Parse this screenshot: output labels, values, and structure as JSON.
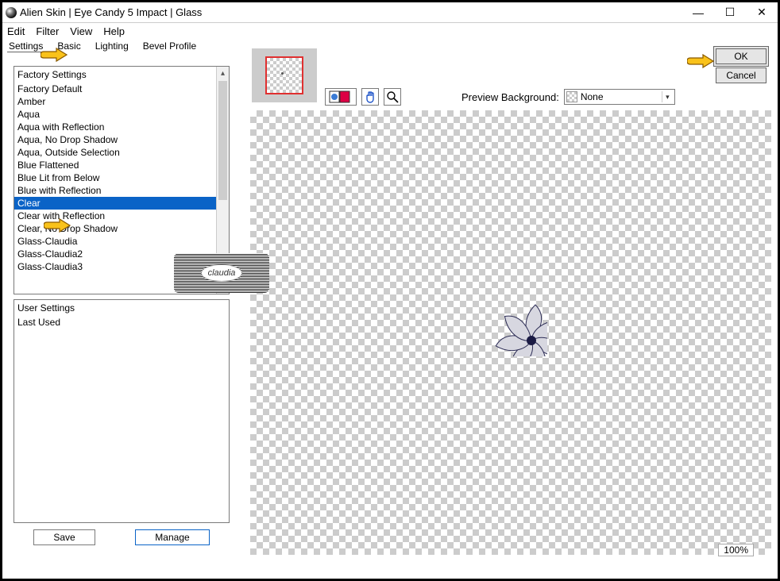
{
  "window": {
    "title": "Alien Skin | Eye Candy 5 Impact | Glass"
  },
  "menu": {
    "edit": "Edit",
    "filter": "Filter",
    "view": "View",
    "help": "Help"
  },
  "tabs": {
    "settings": "Settings",
    "basic": "Basic",
    "lighting": "Lighting",
    "bevel": "Bevel Profile"
  },
  "presets": {
    "header": "Factory Settings",
    "items": [
      "Factory Default",
      "Amber",
      "Aqua",
      "Aqua with Reflection",
      "Aqua, No Drop Shadow",
      "Aqua, Outside Selection",
      "Blue Flattened",
      "Blue Lit from Below",
      "Blue with Reflection",
      "Clear",
      "Clear with Reflection",
      "Clear, No Drop Shadow",
      "Glass-Claudia",
      "Glass-Claudia2",
      "Glass-Claudia3"
    ],
    "selected_index": 9
  },
  "user": {
    "header": "User Settings",
    "items": [
      "Last Used"
    ]
  },
  "buttons": {
    "save": "Save",
    "manage": "Manage",
    "ok": "OK",
    "cancel": "Cancel"
  },
  "preview": {
    "label": "Preview Background:",
    "value": "None"
  },
  "zoom": "100%",
  "watermark": "claudia"
}
